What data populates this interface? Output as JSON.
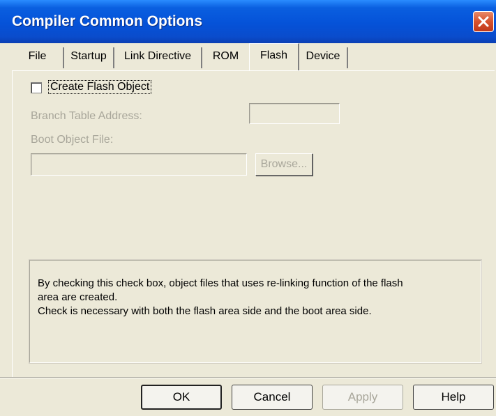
{
  "window": {
    "title": "Compiler Common Options"
  },
  "tabs": [
    {
      "label": "File",
      "active": false
    },
    {
      "label": "Startup",
      "active": false
    },
    {
      "label": "Link Directive",
      "active": false
    },
    {
      "label": "ROM",
      "active": false
    },
    {
      "label": "Flash",
      "active": true
    },
    {
      "label": "Device",
      "active": false
    }
  ],
  "flash": {
    "create_flash_object": {
      "label": "Create Flash Object",
      "checked": false
    },
    "branch_table_address": {
      "label": "Branch Table Address:",
      "value": "",
      "enabled": false
    },
    "boot_object_file": {
      "label": "Boot Object File:",
      "value": "",
      "enabled": false
    },
    "browse_label": "Browse..."
  },
  "info": {
    "line1": "By checking this check box, object files that uses re-linking function of the flash",
    "line2": "area are created.",
    "line3": "Check is necessary with both the flash area side and the boot area side."
  },
  "buttons": {
    "ok": "OK",
    "cancel": "Cancel",
    "apply": "Apply",
    "help": "Help"
  },
  "colors": {
    "title_bar": "#0552d8",
    "dialog_bg": "#ece9d8",
    "disabled_text": "#a8a69a",
    "close_button": "#d6522e"
  }
}
